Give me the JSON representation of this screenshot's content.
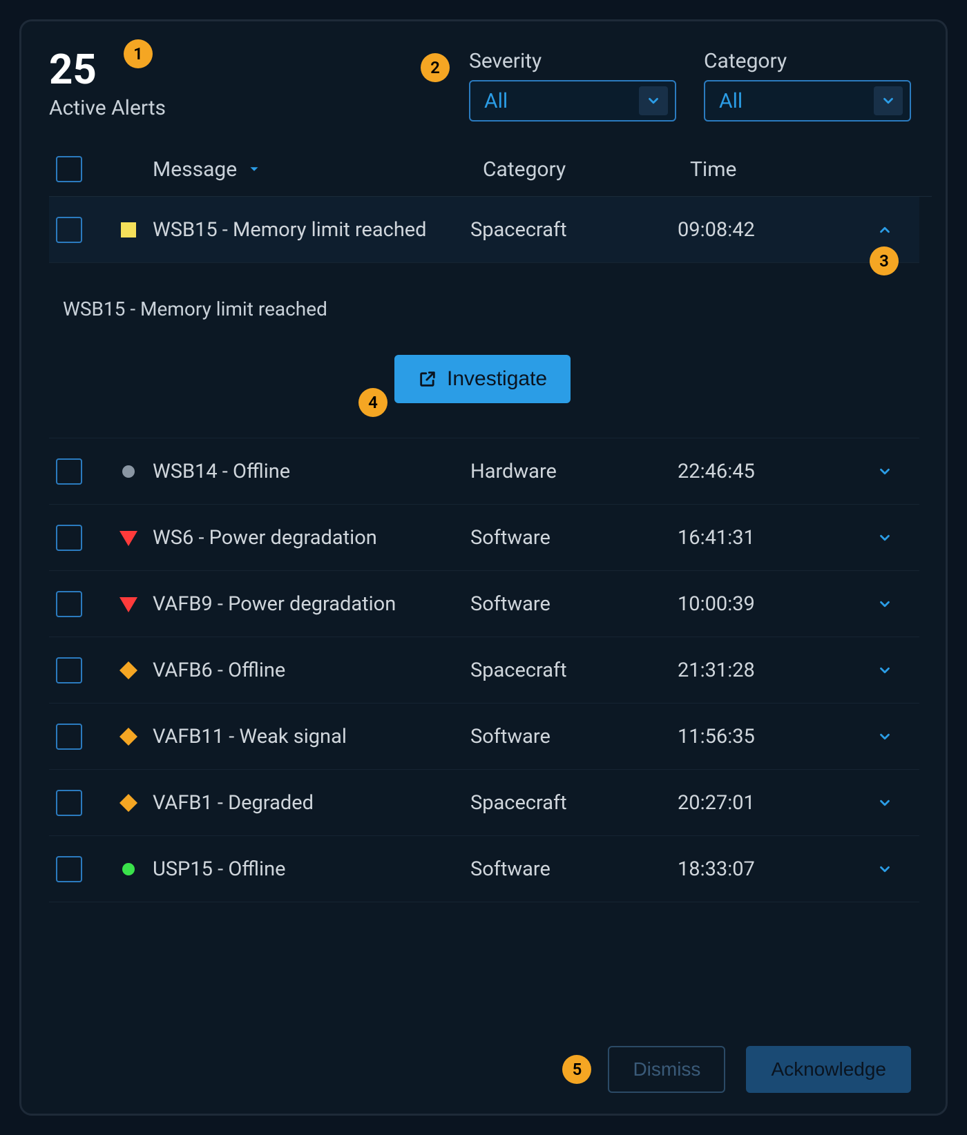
{
  "header": {
    "count": "25",
    "count_label": "Active Alerts"
  },
  "filters": {
    "severity": {
      "label": "Severity",
      "value": "All"
    },
    "category": {
      "label": "Category",
      "value": "All"
    }
  },
  "columns": {
    "message": "Message",
    "category": "Category",
    "time": "Time"
  },
  "expanded": {
    "detail_msg": "WSB15 - Memory limit reached",
    "investigate_label": "Investigate"
  },
  "rows": [
    {
      "sev": "yellow-square",
      "message": "WSB15 - Memory limit reached",
      "category": "Spacecraft",
      "time": "09:08:42",
      "expanded": true
    },
    {
      "sev": "gray-dot",
      "message": "WSB14 - Offline",
      "category": "Hardware",
      "time": "22:46:45",
      "expanded": false
    },
    {
      "sev": "red-triangle",
      "message": "WS6 - Power degradation",
      "category": "Software",
      "time": "16:41:31",
      "expanded": false
    },
    {
      "sev": "red-triangle",
      "message": "VAFB9 - Power degradation",
      "category": "Software",
      "time": "10:00:39",
      "expanded": false
    },
    {
      "sev": "orange-diamond",
      "message": "VAFB6 - Offline",
      "category": "Spacecraft",
      "time": "21:31:28",
      "expanded": false
    },
    {
      "sev": "orange-diamond",
      "message": "VAFB11 - Weak signal",
      "category": "Software",
      "time": "11:56:35",
      "expanded": false
    },
    {
      "sev": "orange-diamond",
      "message": "VAFB1 - Degraded",
      "category": "Spacecraft",
      "time": "20:27:01",
      "expanded": false
    },
    {
      "sev": "green-dot",
      "message": "USP15 - Offline",
      "category": "Software",
      "time": "18:33:07",
      "expanded": false
    }
  ],
  "footer": {
    "dismiss": "Dismiss",
    "acknowledge": "Acknowledge"
  },
  "callouts": [
    "1",
    "2",
    "3",
    "4",
    "5"
  ],
  "colors": {
    "accent": "#2b9de6",
    "yellow": "#f5e05a",
    "red": "#ff3b3b",
    "orange": "#f5a623",
    "gray": "#8a96a3",
    "green": "#3ae24b"
  }
}
